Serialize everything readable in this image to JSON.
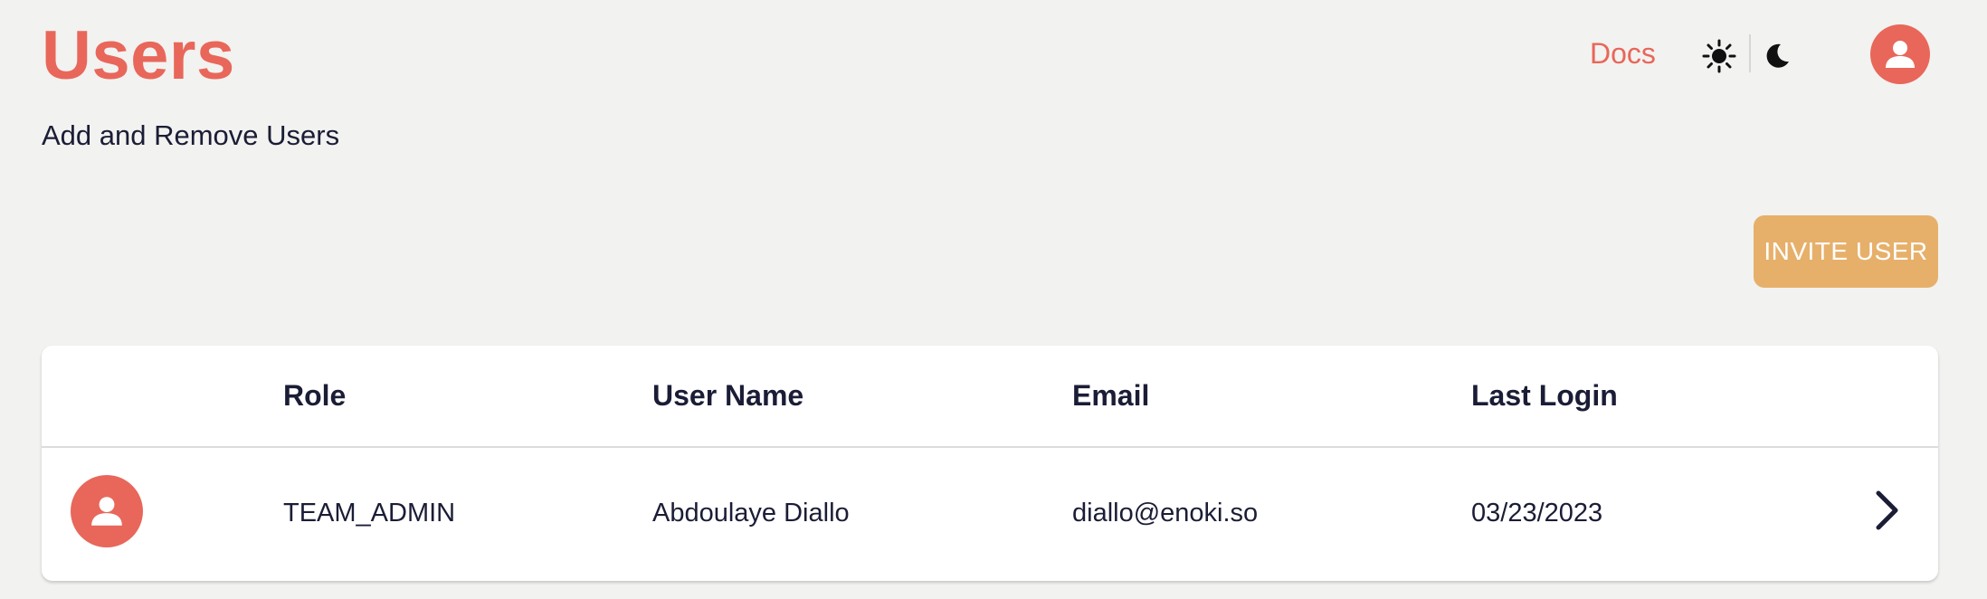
{
  "header": {
    "title": "Users",
    "subtitle": "Add and Remove Users",
    "docs_label": "Docs"
  },
  "theme": {
    "light_icon": "sun-icon",
    "dark_icon": "moon-icon"
  },
  "actions": {
    "invite_label": "INVITE USER"
  },
  "table": {
    "columns": [
      "Role",
      "User Name",
      "Email",
      "Last Login"
    ],
    "rows": [
      {
        "role": "TEAM_ADMIN",
        "user_name": "Abdoulaye Diallo",
        "email": "diallo@enoki.so",
        "last_login": "03/23/2023"
      }
    ]
  },
  "colors": {
    "accent": "#e8675a",
    "button": "#e6b06b",
    "text": "#1b1d36",
    "background": "#f2f2f0"
  }
}
